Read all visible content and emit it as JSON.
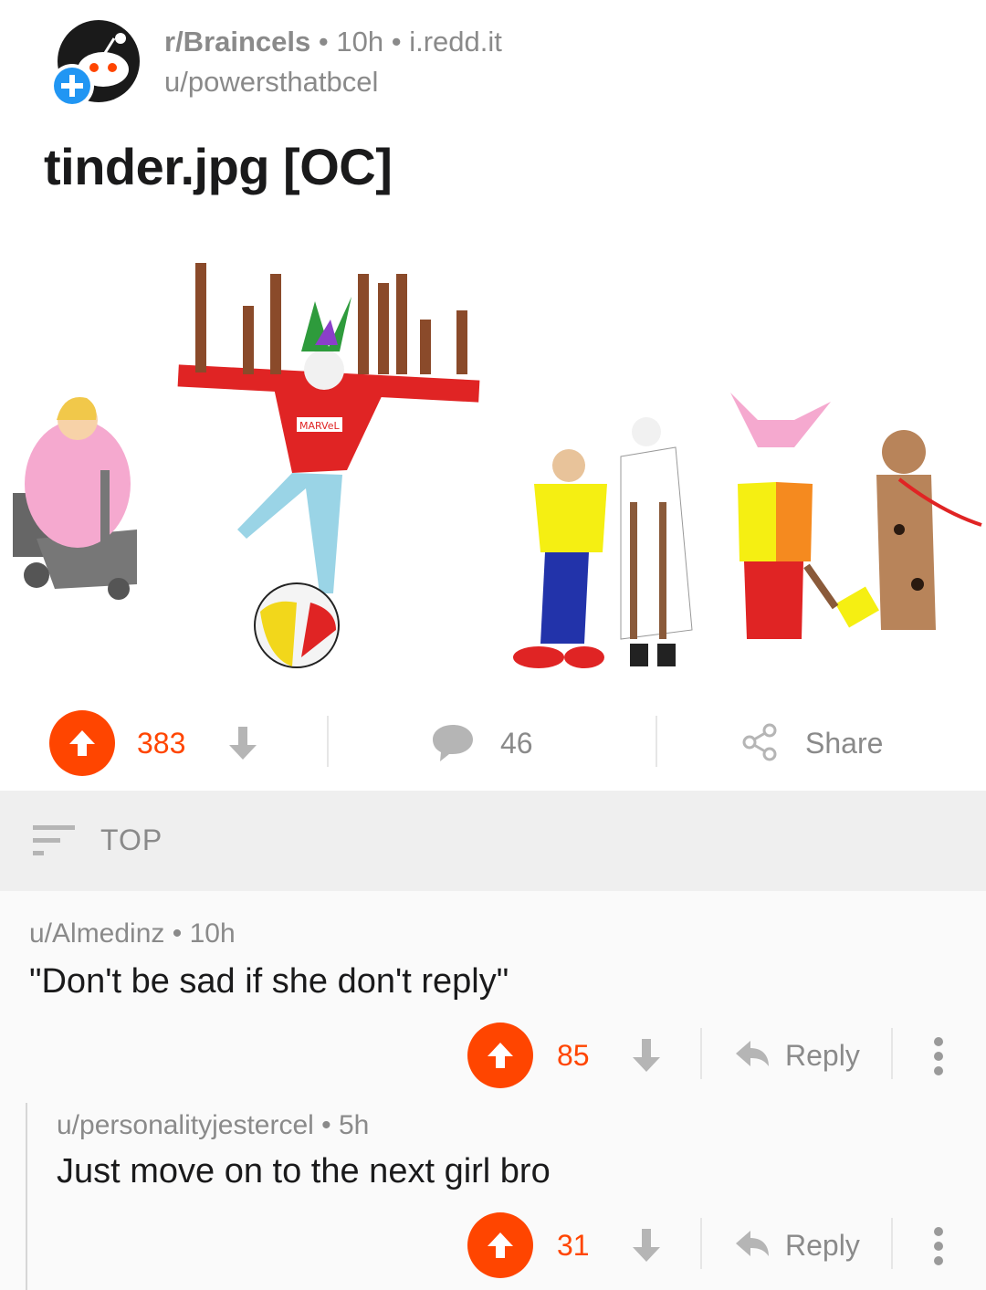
{
  "post": {
    "subreddit": "r/Braincels",
    "time": "10h",
    "domain": "i.redd.it",
    "author": "u/powersthatbcel",
    "title": "tinder.jpg [OC]",
    "image_text": "MARVeL",
    "score": "383",
    "comment_count": "46",
    "share_label": "Share"
  },
  "sort": {
    "label": "TOP"
  },
  "comments": [
    {
      "author": "u/Almedinz",
      "time": "10h",
      "body": "\"Don't be sad if she don't reply\"",
      "score": "85",
      "reply_label": "Reply"
    },
    {
      "author": "u/personalityjestercel",
      "time": "5h",
      "body": "Just move on to the next girl bro",
      "score": "31",
      "reply_label": "Reply"
    }
  ],
  "colors": {
    "accent": "#ff4500",
    "muted": "#8a8a8a",
    "sort_bg": "#efefef"
  },
  "icons": [
    "reddit-snoo-icon",
    "add-icon",
    "upvote-arrow-icon",
    "downvote-arrow-icon",
    "comment-bubble-icon",
    "share-icon",
    "sort-icon",
    "reply-arrow-icon",
    "more-options-icon"
  ]
}
